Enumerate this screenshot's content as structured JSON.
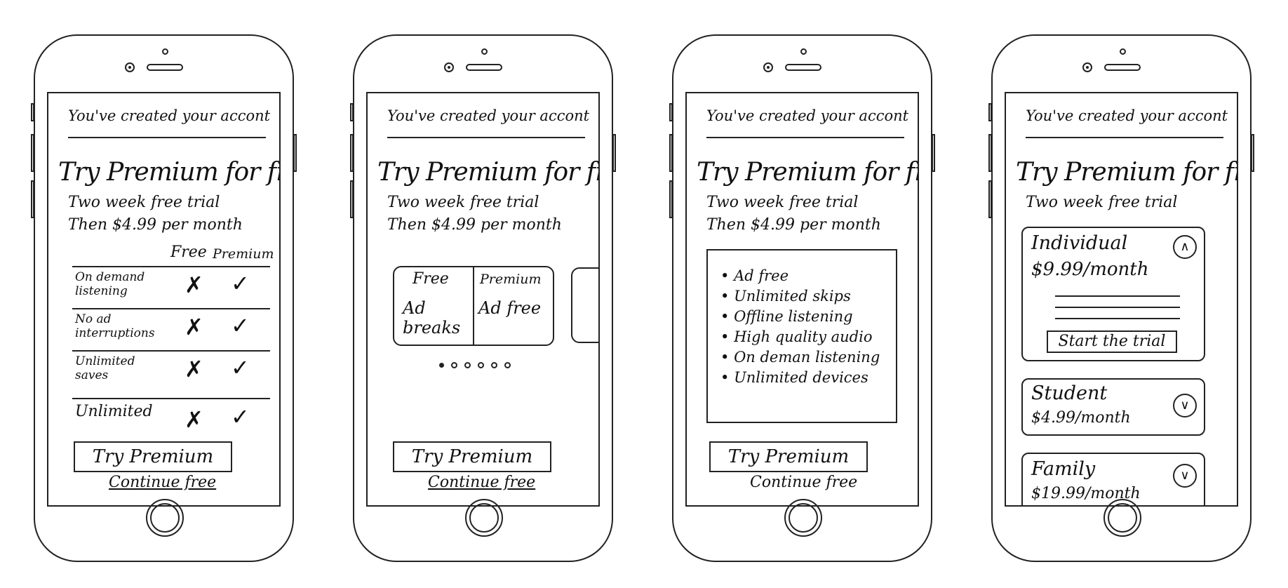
{
  "shared": {
    "header": "You've created your accont",
    "title": "Try Premium for free",
    "subtitle": "Two week free trial",
    "price_line": "Then $4.99 per month",
    "cta": "Try Premium",
    "continue": "Continue free"
  },
  "screen1": {
    "col_free": "Free",
    "col_premium": "Premium",
    "rows": [
      {
        "label": "On demand listening",
        "free": "✗",
        "premium": "✓"
      },
      {
        "label": "No ad interruptions",
        "free": "✗",
        "premium": "✓"
      },
      {
        "label": "Unlimited saves",
        "free": "✗",
        "premium": "✓"
      },
      {
        "label": "Unlimited",
        "free": "✗",
        "premium": "✓"
      }
    ]
  },
  "screen2": {
    "card_free_title": "Free",
    "card_free_body": "Ad breaks",
    "card_premium_title": "Premium",
    "card_premium_body": "Ad free",
    "dot_count": 6,
    "active_dot": 0
  },
  "screen3": {
    "features": [
      "Ad free",
      "Unlimited skips",
      "Offline listening",
      "High quality audio",
      "On deman listening",
      "Unlimited devices"
    ]
  },
  "screen4": {
    "plans": [
      {
        "name": "Individual",
        "price": "$9.99/month",
        "toggle": "∧",
        "cta": "Start the trial"
      },
      {
        "name": "Student",
        "price": "$4.99/month",
        "toggle": "∨"
      },
      {
        "name": "Family",
        "price": "$19.99/month",
        "toggle": "∨"
      }
    ]
  }
}
